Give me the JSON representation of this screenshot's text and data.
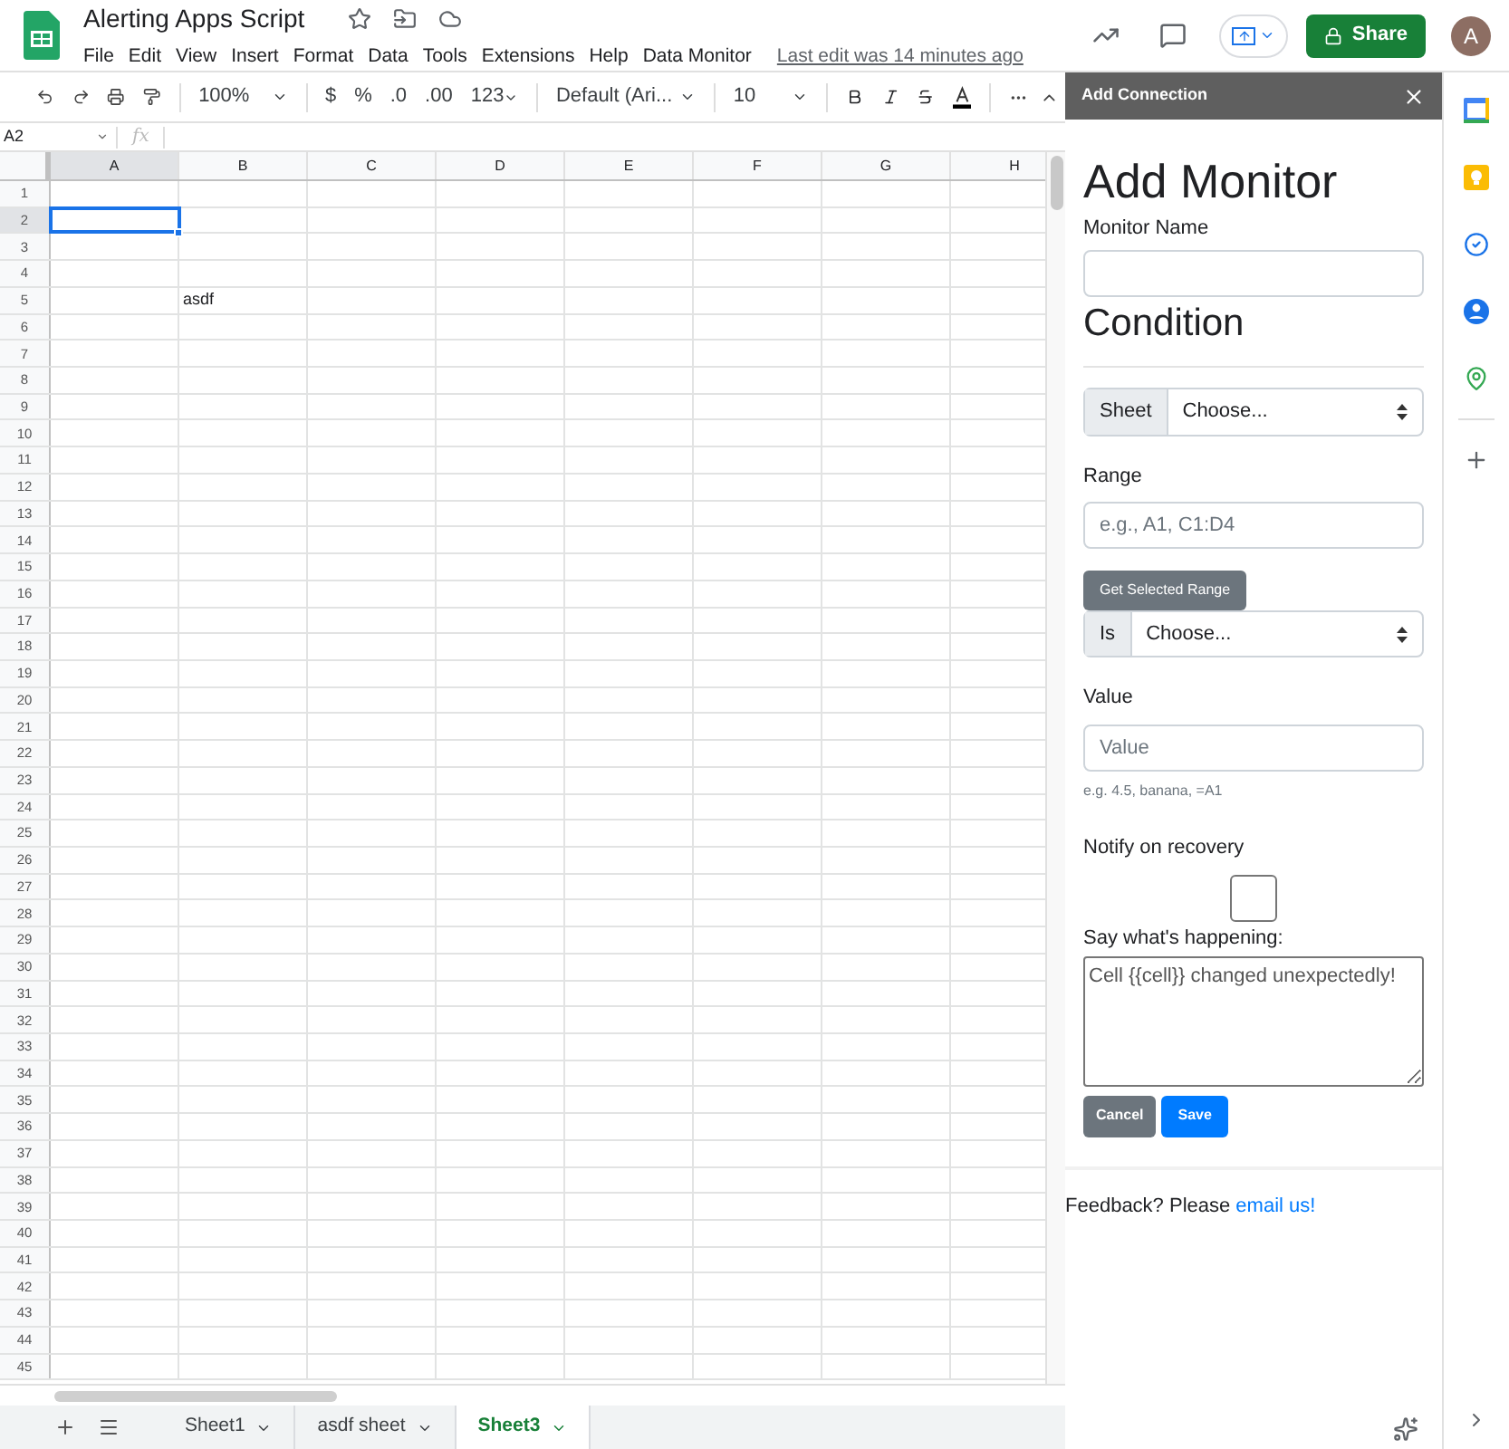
{
  "document": {
    "title": "Alerting Apps Script",
    "last_edit": "Last edit was 14 minutes ago"
  },
  "menu": [
    "File",
    "Edit",
    "View",
    "Insert",
    "Format",
    "Data",
    "Tools",
    "Extensions",
    "Help",
    "Data Monitor"
  ],
  "share_button": "Share",
  "avatar": "A",
  "toolbar": {
    "zoom": "100%",
    "currency": "$",
    "percent": "%",
    "decrease_decimals": ".0",
    "increase_decimals": ".00",
    "more_formats": "123",
    "font": "Default (Ari...",
    "font_size": "10"
  },
  "formula_bar": {
    "name_box": "A2",
    "function_label": "fx"
  },
  "columns": [
    {
      "label": "A",
      "selected": true
    },
    {
      "label": "B",
      "selected": false
    },
    {
      "label": "C",
      "selected": false
    },
    {
      "label": "D",
      "selected": false
    },
    {
      "label": "E",
      "selected": false
    },
    {
      "label": "F",
      "selected": false
    },
    {
      "label": "G",
      "selected": false
    },
    {
      "label": "H",
      "selected": false
    }
  ],
  "rows": [
    {
      "label": "1",
      "selected": false
    },
    {
      "label": "2",
      "selected": true
    },
    {
      "label": "3",
      "selected": false
    },
    {
      "label": "4",
      "selected": false
    },
    {
      "label": "5",
      "selected": false,
      "cells": [
        null,
        "asdf"
      ]
    },
    {
      "label": "6",
      "selected": false
    },
    {
      "label": "7",
      "selected": false
    },
    {
      "label": "8",
      "selected": false
    },
    {
      "label": "9",
      "selected": false
    },
    {
      "label": "10",
      "selected": false
    },
    {
      "label": "11",
      "selected": false
    },
    {
      "label": "12",
      "selected": false
    },
    {
      "label": "13",
      "selected": false
    },
    {
      "label": "14",
      "selected": false
    },
    {
      "label": "15",
      "selected": false
    },
    {
      "label": "16",
      "selected": false
    },
    {
      "label": "17",
      "selected": false
    },
    {
      "label": "18",
      "selected": false
    },
    {
      "label": "19",
      "selected": false
    },
    {
      "label": "20",
      "selected": false
    },
    {
      "label": "21",
      "selected": false
    },
    {
      "label": "22",
      "selected": false
    },
    {
      "label": "23",
      "selected": false
    },
    {
      "label": "24",
      "selected": false
    },
    {
      "label": "25",
      "selected": false
    },
    {
      "label": "26",
      "selected": false
    },
    {
      "label": "27",
      "selected": false
    },
    {
      "label": "28",
      "selected": false
    },
    {
      "label": "29",
      "selected": false
    },
    {
      "label": "30",
      "selected": false
    },
    {
      "label": "31",
      "selected": false
    },
    {
      "label": "32",
      "selected": false
    },
    {
      "label": "33",
      "selected": false
    },
    {
      "label": "34",
      "selected": false
    },
    {
      "label": "35",
      "selected": false
    },
    {
      "label": "36",
      "selected": false
    },
    {
      "label": "37",
      "selected": false
    },
    {
      "label": "38",
      "selected": false
    },
    {
      "label": "39",
      "selected": false
    },
    {
      "label": "40",
      "selected": false
    },
    {
      "label": "41",
      "selected": false
    },
    {
      "label": "42",
      "selected": false
    },
    {
      "label": "43",
      "selected": false
    },
    {
      "label": "44",
      "selected": false
    },
    {
      "label": "45",
      "selected": false
    }
  ],
  "sheet_tabs": [
    {
      "label": "Sheet1",
      "selected": false
    },
    {
      "label": "asdf sheet",
      "selected": false
    },
    {
      "label": "Sheet3",
      "selected": true
    }
  ],
  "sidebar": {
    "title": "Add Connection",
    "heading": "Add Monitor",
    "monitor_name_label": "Monitor Name",
    "condition_heading": "Condition",
    "sheet_select": {
      "prefix": "Sheet",
      "value": "Choose..."
    },
    "range_label": "Range",
    "range_placeholder": "e.g., A1, C1:D4",
    "get_range_button": "Get Selected Range",
    "is_select": {
      "prefix": "Is",
      "value": "Choose..."
    },
    "value_label": "Value",
    "value_placeholder": "Value",
    "value_help": "e.g. 4.5, banana, =A1",
    "notify_label": "Notify on recovery",
    "notify_checked": false,
    "message_label": "Say what's happening:",
    "message_value": "Cell {{cell}} changed unexpectedly!",
    "cancel_button": "Cancel",
    "save_button": "Save",
    "feedback_text": "Feedback? Please ",
    "feedback_link": "email us!"
  }
}
